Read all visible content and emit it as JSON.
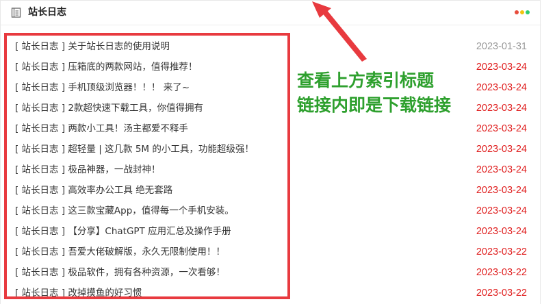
{
  "header": {
    "title": "站长日志",
    "icon": "notebook-icon",
    "menu_icon": "three-dots-icon",
    "dot_colors": [
      "#e74c3c",
      "#f1c40f",
      "#2ecc71"
    ]
  },
  "colors": {
    "date_old": "#999999",
    "date_new": "#e02020",
    "highlight": "#e83a3f",
    "annotation": "#2ea02e"
  },
  "posts": [
    {
      "title": "[ 站长日志 ] 关于站长日志的使用说明",
      "date": "2023-01-31",
      "recent": false
    },
    {
      "title": "[ 站长日志 ] 压箱底的两款网站，值得推荐！",
      "date": "2023-03-24",
      "recent": true
    },
    {
      "title": "[ 站长日志 ] 手机顶级浏览器！！！ 来了~",
      "date": "2023-03-24",
      "recent": true
    },
    {
      "title": "[ 站长日志 ] 2款超快速下载工具，你值得拥有",
      "date": "2023-03-24",
      "recent": true
    },
    {
      "title": "[ 站长日志 ] 两款小工具！汤主都爱不释手",
      "date": "2023-03-24",
      "recent": true
    },
    {
      "title": "[ 站长日志 ] 超轻量 | 这几款 5M 的小工具，功能超级强！",
      "date": "2023-03-24",
      "recent": true
    },
    {
      "title": "[ 站长日志 ] 极品神器，一战封神！",
      "date": "2023-03-24",
      "recent": true
    },
    {
      "title": "[ 站长日志 ] 高效率办公工具 绝无套路",
      "date": "2023-03-24",
      "recent": true
    },
    {
      "title": "[ 站长日志 ] 这三款宝藏App，值得每一个手机安装。",
      "date": "2023-03-24",
      "recent": true
    },
    {
      "title": "[ 站长日志 ] 【分享】ChatGPT 应用汇总及操作手册",
      "date": "2023-03-24",
      "recent": true
    },
    {
      "title": "[ 站长日志 ] 吾爱大佬破解版，永久无限制使用！！",
      "date": "2023-03-22",
      "recent": true
    },
    {
      "title": "[ 站长日志 ] 极品软件，拥有各种资源，一次看够！",
      "date": "2023-03-22",
      "recent": true
    },
    {
      "title": "[ 站长日志 ] 改掉摸鱼的好习惯",
      "date": "2023-03-22",
      "recent": true
    }
  ],
  "annotation": {
    "line1": "查看上方索引标题",
    "line2": "链接内即是下载链接"
  }
}
